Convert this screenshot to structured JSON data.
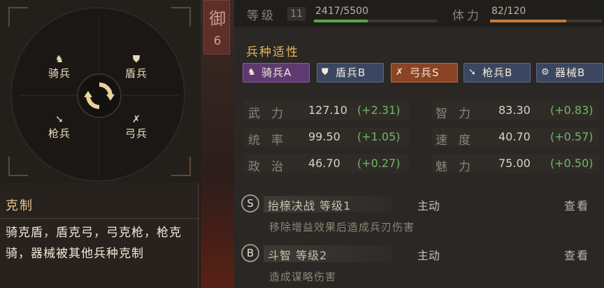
{
  "counter_wheel": {
    "units": [
      {
        "label": "骑兵",
        "icon": "horse-icon"
      },
      {
        "label": "盾兵",
        "icon": "shield-icon"
      },
      {
        "label": "枪兵",
        "icon": "spear-icon"
      },
      {
        "label": "弓兵",
        "icon": "bow-icon"
      }
    ],
    "center_icon": "cycle-arrows-icon"
  },
  "counter_info": {
    "title": "克制",
    "text": "骑克盾，盾克弓，弓克枪，枪克骑，器械被其他兵种克制"
  },
  "rank": {
    "char": "御",
    "num": "6"
  },
  "header": {
    "level_label": "等级",
    "level": "11",
    "exp_text": "2417/5500",
    "exp_fraction": 0.439,
    "stamina_label": "体力",
    "stamina_text": "82/120",
    "stamina_fraction": 0.683
  },
  "aptitude": {
    "title": "兵种适性",
    "items": [
      {
        "label": "骑兵A",
        "icon": "horse-icon"
      },
      {
        "label": "盾兵B",
        "icon": "shield-icon"
      },
      {
        "label": "弓兵S",
        "icon": "bow-icon"
      },
      {
        "label": "枪兵B",
        "icon": "spear-icon"
      },
      {
        "label": "器械B",
        "icon": "gear-icon"
      }
    ]
  },
  "stats": [
    {
      "name": "武力",
      "value": "127.10",
      "bonus": "(+2.31)"
    },
    {
      "name": "智力",
      "value": "83.30",
      "bonus": "(+0.83)"
    },
    {
      "name": "统率",
      "value": "99.50",
      "bonus": "(+1.05)"
    },
    {
      "name": "速度",
      "value": "40.70",
      "bonus": "(+0.57)"
    },
    {
      "name": "政治",
      "value": "46.70",
      "bonus": "(+0.27)"
    },
    {
      "name": "魅力",
      "value": "75.00",
      "bonus": "(+0.50)"
    }
  ],
  "skills": [
    {
      "grade": "S",
      "name": "抬榇决战 等级1",
      "type": "主动",
      "view": "查看",
      "desc": "移除增益效果后造成兵刃伤害"
    },
    {
      "grade": "B",
      "name": "斗智 等级2",
      "type": "主动",
      "view": "查看",
      "desc": "造成谋略伤害"
    }
  ],
  "colors": {
    "exp_bar": "#5aa34a",
    "stamina_bar": "#c47a3a",
    "aptitude_title": "#e3b55e",
    "bonus_green": "#72b566",
    "badge_purple": "#7a4a8e",
    "badge_blue": "#4a5a78",
    "badge_orange": "#a0502a"
  }
}
